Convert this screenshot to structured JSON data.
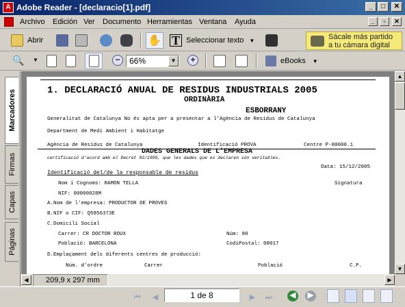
{
  "window": {
    "title": "Adobe Reader - [declaracio[1].pdf]"
  },
  "menu": [
    "Archivo",
    "Edición",
    "Ver",
    "Documento",
    "Herramientas",
    "Ventana",
    "Ayuda"
  ],
  "toolbar": {
    "open_label": "Abrir",
    "select_text_label": "Seleccionar texto",
    "camera_promo": [
      "Sácale más partido",
      "a tu cámara digital"
    ],
    "zoom_value": "66%",
    "ebooks_label": "eBooks"
  },
  "nav_tabs": [
    "Marcadores",
    "Firmas",
    "Capas",
    "Páginas"
  ],
  "document": {
    "title": "1. DECLARACIÓ ANUAL DE RESIDUS INDUSTRIALS 2005",
    "subtitle": "ORDINÀRIA",
    "draft": "ESBORRANY",
    "intro": "Generalitat de Catalunya No és apta per a presentar a l'Agència de Residus de Catalunya",
    "department": "Department de Medi Ambient i Habitatge",
    "agency": "Agència de Residus de Catalunya",
    "identification": "Identificació PROVA",
    "centre": "Centre P-00000.1",
    "section_heading": "DADES GENERALS DE L'EMPRESA",
    "certification": "certificació d'acord amb el Decret 93/1999, que les dades que es declaren són veritables.",
    "date": "Data: 15/12/2005",
    "responsible_heading": "Identificació del/de la responsable de residus",
    "name_line": "Nom i Cognoms: RAMON TELLA",
    "signature": "Signatura",
    "nif": "NIF: 00000028M",
    "company_name": "A.Nom de l'empresa: PRODUCTOR DE PROVES",
    "company_nif": "B.NIF o CIF: Q5856373E",
    "address_heading": "C.Domicili Social",
    "street": "Carrer: CR DOCTOR ROUX",
    "street_number": "Núm: 80",
    "town": "Població: BARCELONA",
    "postal_code": "CodiPostal: 08017",
    "locations_heading": "D.Emplaçament dels diferents centres de producció:",
    "table_headers": [
      "Núm. d'ordre",
      "Carrer",
      "Població",
      "C.P."
    ]
  },
  "status": {
    "page_size": "209,9 x 297 mm",
    "page_indicator": "1 de 8"
  },
  "colors": {
    "titlebar": "#0a246a",
    "chrome": "#d4d0c8",
    "promo": "#f5e97a"
  }
}
